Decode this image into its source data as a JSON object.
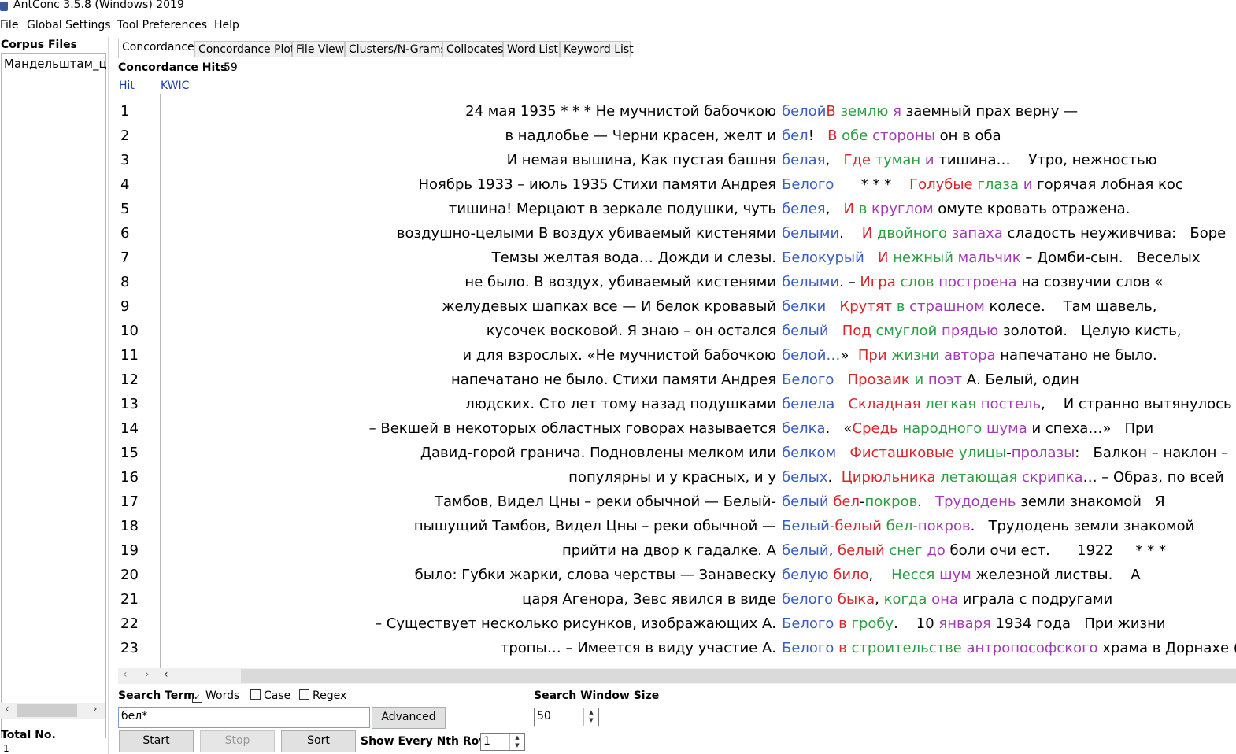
{
  "window": {
    "title": "AntConc 3.5.8 (Windows) 2019"
  },
  "menu": [
    "File",
    "Global Settings",
    "Tool Preferences",
    "Help"
  ],
  "corpus": {
    "title": "Corpus Files",
    "files": [
      "Мандельштам_ц"
    ],
    "total_label": "Total No.",
    "total_value": "1"
  },
  "tabs": [
    "Concordance",
    "Concordance Plot",
    "File View",
    "Clusters/N-Grams",
    "Collocates",
    "Word List",
    "Keyword List"
  ],
  "active_tab": 0,
  "concordance": {
    "hits_label": "Concordance Hits",
    "hits_value": "59",
    "col_hit": "Hit",
    "col_kwic": "KWIC",
    "rows": [
      {
        "n": "1",
        "left": "24 мая 1935    * * *    Не мучнистой бабочкою",
        "kw": "белой",
        "right": [
          [
            "В",
            "red"
          ],
          [
            " ",
            "k"
          ],
          [
            "землю",
            "green"
          ],
          [
            " ",
            "k"
          ],
          [
            "я",
            "purple"
          ],
          [
            " заемный прах верну —",
            "k"
          ]
        ]
      },
      {
        "n": "2",
        "left": "в надлобье —   Черни красен, желт и",
        "kw": "бел",
        "right": [
          [
            "!   ",
            "k"
          ],
          [
            "В",
            "red"
          ],
          [
            " ",
            "k"
          ],
          [
            "обе",
            "green"
          ],
          [
            " ",
            "k"
          ],
          [
            "стороны",
            "purple"
          ],
          [
            " он в оба",
            "k"
          ]
        ]
      },
      {
        "n": "3",
        "left": "И немая вышина,   Как пустая башня",
        "kw": "белая",
        "right": [
          [
            ",   ",
            "k"
          ],
          [
            "Где",
            "red"
          ],
          [
            " ",
            "k"
          ],
          [
            "туман",
            "green"
          ],
          [
            " ",
            "k"
          ],
          [
            "и",
            "purple"
          ],
          [
            " тишина…    Утро, нежностью",
            "k"
          ]
        ]
      },
      {
        "n": "4",
        "left": "Ноябрь 1933 – июль 1935    Стихи памяти Андрея",
        "kw": "Белого",
        "right": [
          [
            "      * * *    ",
            "k"
          ],
          [
            "Голубые",
            "red"
          ],
          [
            " ",
            "k"
          ],
          [
            "глаза",
            "green"
          ],
          [
            " ",
            "k"
          ],
          [
            "и",
            "purple"
          ],
          [
            " горячая лобная кос",
            "k"
          ]
        ]
      },
      {
        "n": "5",
        "left": "тишина!   Мерцают в зеркале подушки, чуть",
        "kw": "белея",
        "right": [
          [
            ",   ",
            "k"
          ],
          [
            "И",
            "red"
          ],
          [
            " ",
            "k"
          ],
          [
            "в",
            "green"
          ],
          [
            " ",
            "k"
          ],
          [
            "круглом",
            "purple"
          ],
          [
            " омуте кровать отражена.",
            "k"
          ]
        ]
      },
      {
        "n": "6",
        "left": "воздушно-целыми    В воздух убиваемый кистенями",
        "kw": "белыми",
        "right": [
          [
            ".    ",
            "k"
          ],
          [
            "И",
            "red"
          ],
          [
            " ",
            "k"
          ],
          [
            "двойного",
            "green"
          ],
          [
            " ",
            "k"
          ],
          [
            "запаха",
            "purple"
          ],
          [
            " сладость неуживчива:   Боре",
            "k"
          ]
        ]
      },
      {
        "n": "7",
        "left": "Темзы желтая вода…    Дожди и слезы.",
        "kw": "Белокурый",
        "right": [
          [
            "   ",
            "k"
          ],
          [
            "И",
            "red"
          ],
          [
            " ",
            "k"
          ],
          [
            "нежный",
            "green"
          ],
          [
            " ",
            "k"
          ],
          [
            "мальчик",
            "purple"
          ],
          [
            " – Домби-сын.   Веселых",
            "k"
          ]
        ]
      },
      {
        "n": "8",
        "left": "не было.  В воздух, убиваемый кистенями",
        "kw": "белыми",
        "right": [
          [
            ". – ",
            "k"
          ],
          [
            "Игра",
            "red"
          ],
          [
            " ",
            "k"
          ],
          [
            "слов",
            "green"
          ],
          [
            " ",
            "k"
          ],
          [
            "построена",
            "purple"
          ],
          [
            " на созвучии слов «",
            "k"
          ]
        ]
      },
      {
        "n": "9",
        "left": "желудевых шапках все —   И белок кровавый",
        "kw": "белки",
        "right": [
          [
            "   ",
            "k"
          ],
          [
            "Крутят",
            "red"
          ],
          [
            " ",
            "k"
          ],
          [
            "в",
            "green"
          ],
          [
            " ",
            "k"
          ],
          [
            "страшном",
            "purple"
          ],
          [
            " колесе.    Там щавель,",
            "k"
          ]
        ]
      },
      {
        "n": "10",
        "left": "кусочек восковой.   Я знаю – он остался",
        "kw": "белый",
        "right": [
          [
            "   ",
            "k"
          ],
          [
            "Под",
            "red"
          ],
          [
            " ",
            "k"
          ],
          [
            "смуглой",
            "green"
          ],
          [
            " ",
            "k"
          ],
          [
            "прядью",
            "purple"
          ],
          [
            " золотой.   Целую кисть,",
            "k"
          ]
        ]
      },
      {
        "n": "11",
        "left": "и для взрослых.   «Не мучнистой бабочкою",
        "kw": "белой…",
        "right": [
          [
            "»  ",
            "k"
          ],
          [
            "При",
            "red"
          ],
          [
            " ",
            "k"
          ],
          [
            "жизни",
            "green"
          ],
          [
            " ",
            "k"
          ],
          [
            "автора",
            "purple"
          ],
          [
            " напечатано не было.",
            "k"
          ]
        ]
      },
      {
        "n": "12",
        "left": "напечатано не было.   Стихи памяти Андрея",
        "kw": "Белого",
        "right": [
          [
            "   ",
            "k"
          ],
          [
            "Прозаик",
            "red"
          ],
          [
            " ",
            "k"
          ],
          [
            "и",
            "green"
          ],
          [
            " ",
            "k"
          ],
          [
            "поэт",
            "purple"
          ],
          [
            " А. Белый, один",
            "k"
          ]
        ]
      },
      {
        "n": "13",
        "left": "людских.    Сто лет тому назад подушками",
        "kw": "белела",
        "right": [
          [
            "   ",
            "k"
          ],
          [
            "Складная",
            "red"
          ],
          [
            " ",
            "k"
          ],
          [
            "легкая",
            "green"
          ],
          [
            " ",
            "k"
          ],
          [
            "постель",
            "purple"
          ],
          [
            ",    И странно вытянулось",
            "k"
          ]
        ]
      },
      {
        "n": "14",
        "left": "– Векшей в некоторых областных говорах называется",
        "kw": "белка",
        "right": [
          [
            ".   «",
            "k"
          ],
          [
            "Средь",
            "red"
          ],
          [
            " ",
            "k"
          ],
          [
            "народного",
            "green"
          ],
          [
            " ",
            "k"
          ],
          [
            "шума",
            "purple"
          ],
          [
            " и спеха…»   При",
            "k"
          ]
        ]
      },
      {
        "n": "15",
        "left": "Давид-горой гранича.    Подновлены мелком или",
        "kw": "белком",
        "right": [
          [
            "   ",
            "k"
          ],
          [
            "Фисташковые",
            "red"
          ],
          [
            " ",
            "k"
          ],
          [
            "улицы",
            "green"
          ],
          [
            "-",
            "k"
          ],
          [
            "пролазы",
            "purple"
          ],
          [
            ":   Балкон – наклон –",
            "k"
          ]
        ]
      },
      {
        "n": "16",
        "left": "популярны и у красных, и у",
        "kw": "белых",
        "right": [
          [
            ".  ",
            "k"
          ],
          [
            "Цирюльника",
            "red"
          ],
          [
            " ",
            "k"
          ],
          [
            "летающая",
            "green"
          ],
          [
            " ",
            "k"
          ],
          [
            "скрипка",
            "purple"
          ],
          [
            "… – Образ, по всей",
            "k"
          ]
        ]
      },
      {
        "n": "17",
        "left": "Тамбов,   Видел Цны – реки обычной —   Белый-",
        "kw": "белый",
        "right": [
          [
            " ",
            "k"
          ],
          [
            "бел",
            "red"
          ],
          [
            "-",
            "k"
          ],
          [
            "покров",
            "green"
          ],
          [
            ".   ",
            "k"
          ],
          [
            "Трудодень",
            "purple"
          ],
          [
            " земли знакомой   Я",
            "k"
          ]
        ]
      },
      {
        "n": "18",
        "left": "пышущий Тамбов,   Видел Цны – реки обычной —",
        "kw": "Белый",
        "right": [
          [
            "-",
            "k"
          ],
          [
            "белый",
            "red"
          ],
          [
            " ",
            "k"
          ],
          [
            "бел",
            "green"
          ],
          [
            "-",
            "k"
          ],
          [
            "покров",
            "purple"
          ],
          [
            ".   Трудодень земли знакомой",
            "k"
          ]
        ]
      },
      {
        "n": "19",
        "left": "прийти на двор к гадалке.   А",
        "kw": "белый",
        "right": [
          [
            ", ",
            "k"
          ],
          [
            "белый",
            "red"
          ],
          [
            " ",
            "k"
          ],
          [
            "снег",
            "green"
          ],
          [
            " ",
            "k"
          ],
          [
            "до",
            "purple"
          ],
          [
            " боли очи ест.      1922     * * *",
            "k"
          ]
        ]
      },
      {
        "n": "20",
        "left": "было:   Губки жарки, слова черствы —    Занавеску",
        "kw": "белую",
        "right": [
          [
            " ",
            "k"
          ],
          [
            "било",
            "red"
          ],
          [
            ",    ",
            "k"
          ],
          [
            "Несся",
            "green"
          ],
          [
            " ",
            "k"
          ],
          [
            "шум",
            "purple"
          ],
          [
            " железной листвы.    А",
            "k"
          ]
        ]
      },
      {
        "n": "21",
        "left": "царя Агенора, Зевс явился в виде",
        "kw": "белого",
        "right": [
          [
            " ",
            "k"
          ],
          [
            "быка",
            "red"
          ],
          [
            ", ",
            "k"
          ],
          [
            "когда",
            "green"
          ],
          [
            " ",
            "k"
          ],
          [
            "она",
            "purple"
          ],
          [
            " играла с подругами",
            "k"
          ]
        ]
      },
      {
        "n": "22",
        "left": "– Существует несколько рисунков, изображающих А.",
        "kw": "Белого",
        "right": [
          [
            " ",
            "k"
          ],
          [
            "в",
            "red"
          ],
          [
            " ",
            "k"
          ],
          [
            "гробу",
            "green"
          ],
          [
            ".    10 ",
            "k"
          ],
          [
            "января",
            "purple"
          ],
          [
            " 1934 года   При жизни",
            "k"
          ]
        ]
      },
      {
        "n": "23",
        "left": "тропы… – Имеется в виду участие А.",
        "kw": "Белого",
        "right": [
          [
            " ",
            "k"
          ],
          [
            "в",
            "red"
          ],
          [
            " ",
            "k"
          ],
          [
            "строительстве",
            "green"
          ],
          [
            " ",
            "k"
          ],
          [
            "антропософского",
            "purple"
          ],
          [
            " храма в Дорнахе (",
            "k"
          ]
        ]
      }
    ]
  },
  "search": {
    "label": "Search Term",
    "words_label": "Words",
    "words_checked": true,
    "case_label": "Case",
    "case_checked": false,
    "regex_label": "Regex",
    "regex_checked": false,
    "value": "бел*",
    "advanced_label": "Advanced",
    "window_label": "Search Window Size",
    "window_value": "50",
    "start_label": "Start",
    "stop_label": "Stop",
    "sort_label": "Sort",
    "nth_label": "Show Every Nth Row",
    "nth_value": "1"
  },
  "colors": {
    "kw": "#3a5ec0",
    "red": "#d9262c",
    "green": "#2e9e44",
    "purple": "#a23bb5",
    "link": "#1b3fa8"
  }
}
